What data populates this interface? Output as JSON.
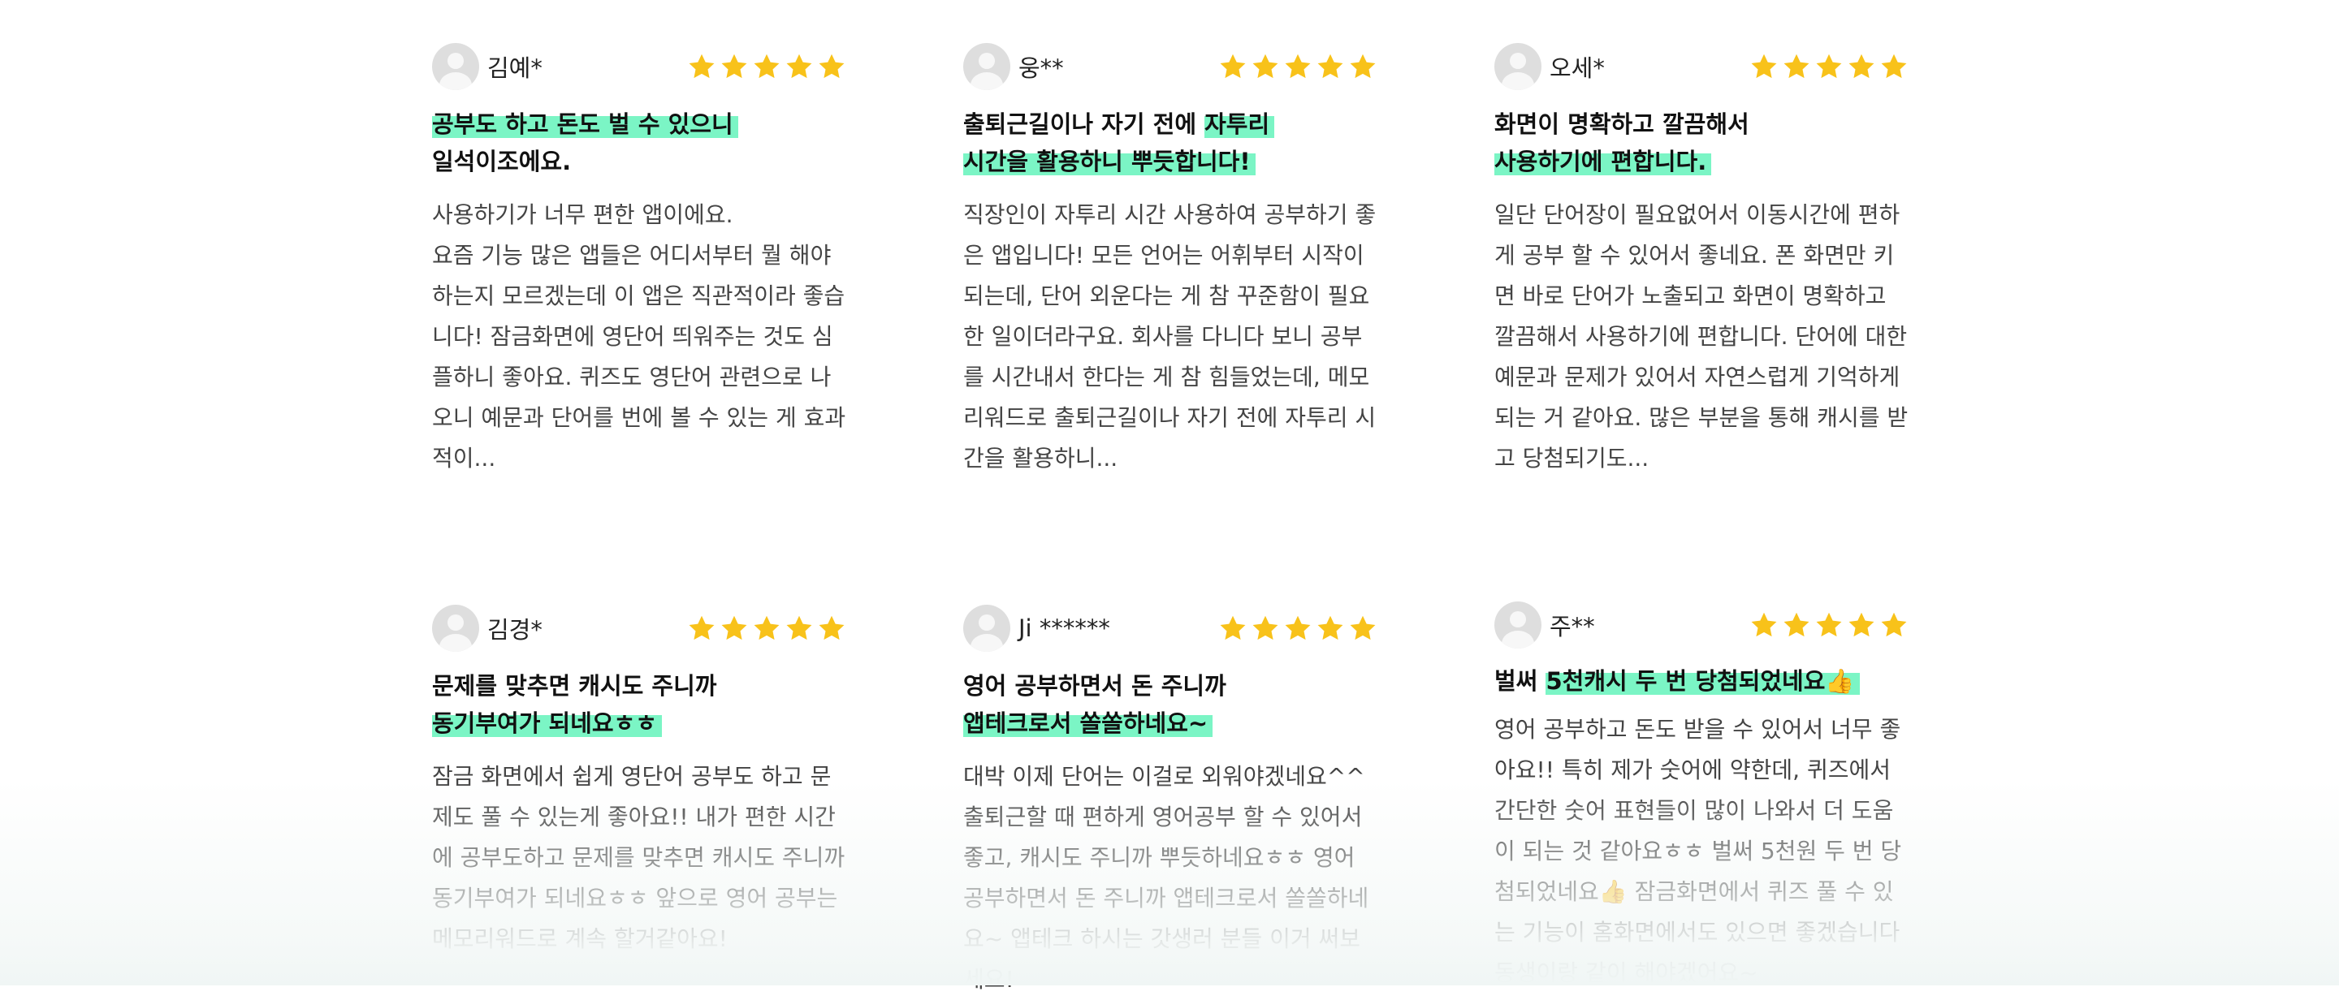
{
  "reviews": [
    {
      "name": "김예*",
      "rating": 5,
      "title_line1": "공부도 하고 돈도 벌 수 있으니",
      "title_line2": "일석이조에요.",
      "body": "사용하기가 너무 편한 앱이에요.\n요즘 기능 많은 앱들은 어디서부터 뭘 해야 하는지 모르겠는데 이 앱은 직관적이라 좋습니다! 잠금화면에 영단어 띄워주는 것도 심플하니 좋아요. 퀴즈도 영단어 관련으로 나오니 예문과 단어를 번에 볼 수 있는 게 효과적이..."
    },
    {
      "name": "웅**",
      "rating": 5,
      "title_line1_plain": "출퇴근길이나 자기 전에 ",
      "title_line1_hl": "자투리",
      "title_line2": "시간을 활용하니 뿌듯합니다!",
      "body": "직장인이 자투리 시간 사용하여 공부하기 좋은 앱입니다! 모든 언어는 어휘부터 시작이 되는데, 단어 외운다는 게 참 꾸준함이 필요 한 일이더라구요. 회사를 다니다 보니 공부를 시간내서 한다는 게 참 힘들었는데, 메모리워드로 출퇴근길이나 자기 전에 자투리 시간을 활용하니..."
    },
    {
      "name": "오세*",
      "rating": 5,
      "title_line1": "화면이 명확하고 깔끔해서",
      "title_line2": "사용하기에 편합니다.",
      "body": "일단 단어장이 필요없어서 이동시간에 편하게 공부 할 수 있어서 좋네요. 폰 화면만 키면 바로 단어가 노출되고 화면이 명확하고 깔끔해서 사용하기에 편합니다. 단어에 대한 예문과 문제가 있어서 자연스럽게 기억하게 되는 거 같아요. 많은 부분을 통해 캐시를 받고 당첨되기도..."
    },
    {
      "name": "김경*",
      "rating": 5,
      "title_line1": "문제를 맞추면 캐시도 주니까",
      "title_line2": "동기부여가 되네요ㅎㅎ",
      "body": "잠금 화면에서 쉽게 영단어 공부도 하고 문제도 풀 수 있는게 좋아요!! 내가 편한 시간에 공부도하고 문제를 맞추면 캐시도 주니까 동기부여가 되네요ㅎㅎ 앞으로 영어 공부는 메모리워드로 계속 할거같아요!"
    },
    {
      "name": "Ji ******",
      "rating": 5,
      "title_line1": "영어 공부하면서 돈 주니까",
      "title_line2": "앱테크로서 쏠쏠하네요~",
      "body": "대박 이제 단어는 이걸로 외워야겠네요^^ 출퇴근할 때 편하게 영어공부 할 수 있어서 좋고, 캐시도 주니까 뿌듯하네요ㅎㅎ 영어 공부하면서 돈 주니까 앱테크로서 쏠쏠하네요~ 앱테크 하시는 갓생러 분들 이거 써보세요!"
    },
    {
      "name": "주**",
      "rating": 5,
      "title_plain": "벌써 ",
      "title_hl": "5천캐시 두 번 당첨되었네요👍",
      "body": "영어 공부하고 돈도 받을 수 있어서 너무 좋아요!! 특히 제가 숫어에 약한데, 퀴즈에서 간단한 숫어 표현들이 많이 나와서 더 도움이 되는 것 같아요ㅎㅎ 벌써 5천원 두 번 당첨되었네요👍 잠금화면에서 퀴즈 풀 수 있는 기능이 홈화면에서도 있으면 좋겠습니다 동생이랑 같이 해야겠어요~"
    }
  ],
  "colors": {
    "highlight": "#7bf5c5",
    "star": "#f8c21a"
  }
}
